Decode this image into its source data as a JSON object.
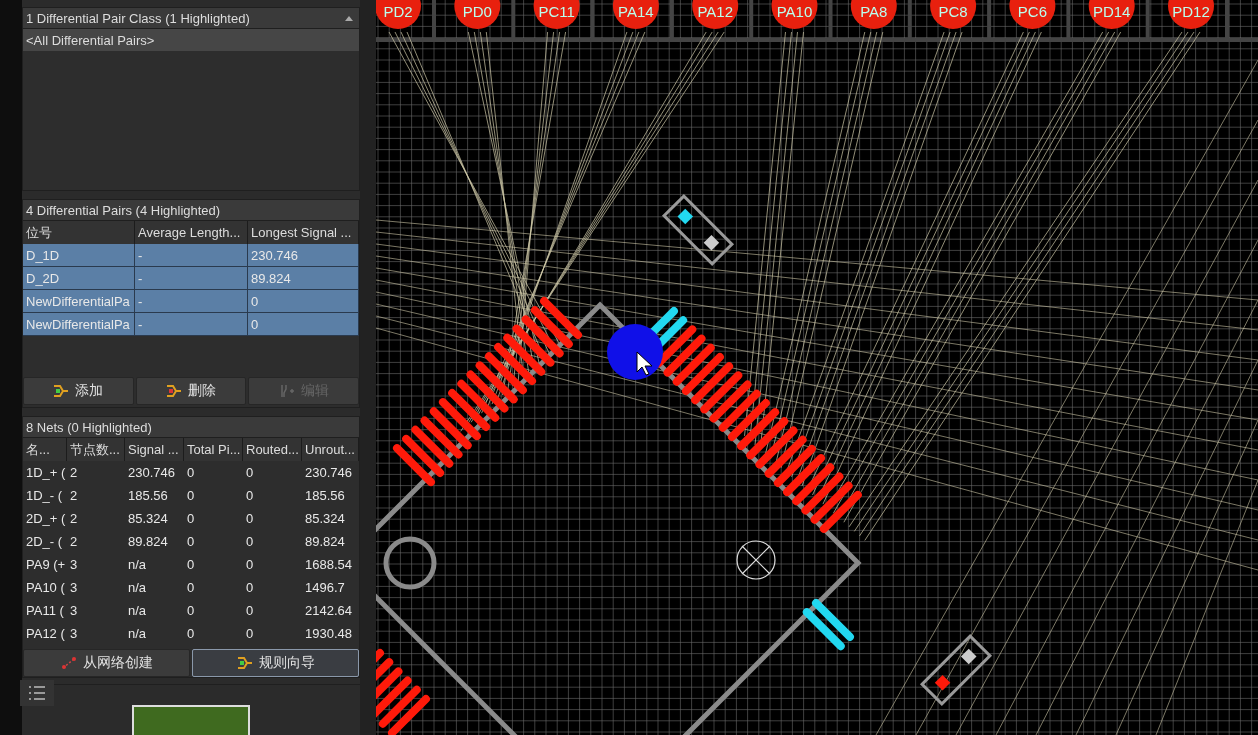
{
  "class_panel": {
    "title": "1 Differential Pair Class (1 Highlighted)",
    "items": [
      {
        "label": "<All Differential Pairs>",
        "selected": true
      }
    ]
  },
  "pairs_panel": {
    "title": "4 Differential Pairs (4 Highlighted)",
    "columns": [
      "位号",
      "Average Length...",
      "Longest Signal ..."
    ],
    "rows": [
      {
        "cells": [
          "D_1D",
          "-",
          "230.746"
        ],
        "selected": true
      },
      {
        "cells": [
          "D_2D",
          "-",
          "89.824"
        ],
        "selected": true
      },
      {
        "cells": [
          "NewDifferentialPa",
          "-",
          "0"
        ],
        "selected": true
      },
      {
        "cells": [
          "NewDifferentialPa",
          "-",
          "0"
        ],
        "selected": true
      }
    ],
    "buttons": [
      {
        "label": "添加",
        "kind": "add",
        "disabled": false
      },
      {
        "label": "删除",
        "kind": "remove",
        "disabled": false
      },
      {
        "label": "编辑",
        "kind": "edit",
        "disabled": true
      }
    ]
  },
  "nets_panel": {
    "title": "8 Nets (0 Highlighted)",
    "columns": [
      "名...",
      "节点数...",
      "Signal ...",
      "Total Pi...",
      "Routed...",
      "Unrout..."
    ],
    "rows": [
      {
        "cells": [
          "1D_+ (",
          "2",
          "230.746",
          "0",
          "0",
          "230.746"
        ],
        "selected": false
      },
      {
        "cells": [
          "1D_- (",
          "2",
          "185.56",
          "0",
          "0",
          "185.56"
        ],
        "selected": false
      },
      {
        "cells": [
          "2D_+ (",
          "2",
          "85.324",
          "0",
          "0",
          "85.324"
        ],
        "selected": false
      },
      {
        "cells": [
          "2D_- (",
          "2",
          "89.824",
          "0",
          "0",
          "89.824"
        ],
        "selected": false
      },
      {
        "cells": [
          "PA9 (+",
          "3",
          "n/a",
          "0",
          "0",
          "1688.54"
        ],
        "selected": false
      },
      {
        "cells": [
          "PA10 (",
          "3",
          "n/a",
          "0",
          "0",
          "1496.7"
        ],
        "selected": false
      },
      {
        "cells": [
          "PA11 (",
          "3",
          "n/a",
          "0",
          "0",
          "2142.64"
        ],
        "selected": false
      },
      {
        "cells": [
          "PA12 (",
          "3",
          "n/a",
          "0",
          "0",
          "1930.48"
        ],
        "selected": false
      }
    ],
    "buttons": [
      {
        "label": "从网络创建",
        "kind": "create",
        "selected": false
      },
      {
        "label": "规则向导",
        "kind": "wizard",
        "selected": true
      }
    ]
  },
  "board": {
    "pad_labels": [
      "PD2",
      "PD0",
      "PC11",
      "PA14",
      "PA12",
      "PA10",
      "PA8",
      "PC8",
      "PC6",
      "PD14",
      "PD12"
    ]
  }
}
